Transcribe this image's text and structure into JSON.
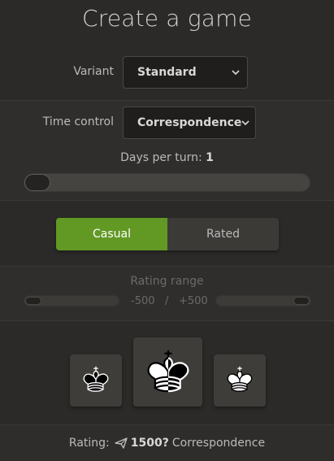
{
  "title": "Create a game",
  "variant": {
    "label": "Variant",
    "value": "Standard"
  },
  "time_control": {
    "label": "Time control",
    "value": "Correspondence"
  },
  "days_per_turn": {
    "label": "Days per turn:",
    "value": "1"
  },
  "mode": {
    "casual": "Casual",
    "rated": "Rated",
    "selected": "Casual"
  },
  "rating_range": {
    "label": "Rating range",
    "min": "-500",
    "separator": "/",
    "max": "+500"
  },
  "colors": [
    {
      "name": "black",
      "icon": "black-king-icon"
    },
    {
      "name": "random",
      "icon": "random-king-icon"
    },
    {
      "name": "white",
      "icon": "white-king-icon"
    }
  ],
  "footer": {
    "label": "Rating:",
    "rating": "1500?",
    "perf": "Correspondence",
    "icon": "paper-plane-icon"
  },
  "accent": "#629924"
}
